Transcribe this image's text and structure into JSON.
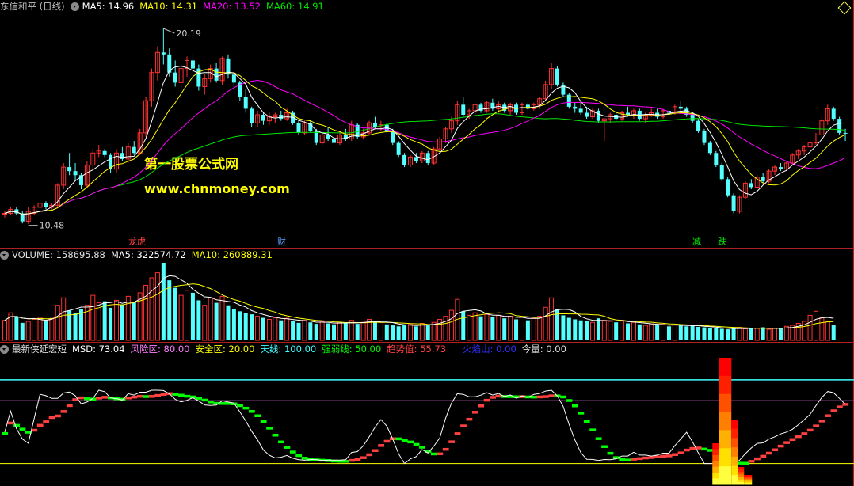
{
  "header_main": {
    "stock": "东信和平 (日线)",
    "ma5": "MA5: 14.96",
    "ma10": "MA10: 14.31",
    "ma20": "MA20: 13.52",
    "ma60": "MA60: 14.91"
  },
  "header_volume": {
    "volume": "VOLUME: 158695.88",
    "ma5": "MA5: 322574.72",
    "ma10": "MA10: 260889.31"
  },
  "header_ind": {
    "name": "最新侠延宏短",
    "msd": "MSD: 73.04",
    "risk": "风险区: 80.00",
    "safe": "安全区: 20.00",
    "sky": "天线: 100.00",
    "strong": "强弱线: 50.00",
    "trend": "趋势值: 55.73",
    "volcano": "火焰山: 0.00",
    "today": "今量: 0.00"
  },
  "watermark": {
    "line1": "第一股票公式网",
    "line2": "www.chnmoney.com"
  },
  "annotations": {
    "high": "20.19",
    "low": "10.48"
  },
  "event_tags": [
    "龙虎",
    "财",
    "减",
    "跌"
  ],
  "colors": {
    "up": "#ff3232",
    "down": "#54ffff",
    "ma5": "#ffffff",
    "ma10": "#ffff00",
    "ma20": "#ff00ff",
    "ma60": "#00e600",
    "risk": "#ff80ff",
    "sky": "#40ffff",
    "strong": "#00ff00",
    "trend": "#ff4040",
    "volcano": "#0000ff"
  },
  "chart_data": {
    "type": "candlestick",
    "price_range": [
      9.8,
      20.9
    ],
    "candles": [
      [
        11.0,
        11.1,
        10.8,
        11.0
      ],
      [
        11.0,
        11.3,
        10.9,
        11.2
      ],
      [
        11.2,
        11.3,
        10.9,
        11.0
      ],
      [
        11.0,
        11.1,
        10.5,
        10.6
      ],
      [
        10.6,
        11.3,
        10.48,
        11.1
      ],
      [
        11.0,
        11.4,
        10.9,
        11.3
      ],
      [
        11.3,
        11.6,
        11.1,
        11.5
      ],
      [
        11.5,
        11.6,
        11.2,
        11.3
      ],
      [
        11.3,
        11.5,
        11.2,
        11.4
      ],
      [
        11.4,
        12.5,
        11.3,
        12.4
      ],
      [
        12.4,
        13.5,
        12.2,
        13.3
      ],
      [
        13.3,
        14.0,
        12.9,
        13.1
      ],
      [
        13.1,
        13.5,
        12.6,
        12.9
      ],
      [
        12.9,
        13.0,
        12.2,
        12.4
      ],
      [
        12.4,
        13.6,
        12.3,
        13.4
      ],
      [
        13.4,
        14.2,
        13.2,
        14.0
      ],
      [
        14.0,
        14.4,
        13.8,
        14.1
      ],
      [
        14.1,
        14.2,
        13.8,
        13.9
      ],
      [
        13.9,
        14.0,
        13.0,
        13.2
      ],
      [
        13.2,
        14.2,
        13.0,
        14.0
      ],
      [
        14.0,
        14.3,
        13.6,
        13.7
      ],
      [
        13.7,
        14.5,
        13.5,
        14.3
      ],
      [
        14.3,
        14.6,
        13.9,
        14.0
      ],
      [
        14.0,
        15.2,
        13.9,
        15.0
      ],
      [
        15.0,
        16.8,
        14.8,
        16.6
      ],
      [
        16.6,
        18.2,
        16.3,
        18.0
      ],
      [
        18.0,
        19.3,
        17.6,
        19.0
      ],
      [
        19.0,
        20.19,
        18.4,
        18.9
      ],
      [
        18.9,
        19.2,
        17.8,
        18.0
      ],
      [
        18.0,
        18.6,
        17.3,
        17.5
      ],
      [
        17.5,
        18.4,
        17.2,
        18.2
      ],
      [
        18.2,
        18.8,
        17.8,
        18.6
      ],
      [
        18.6,
        18.9,
        18.0,
        18.2
      ],
      [
        18.2,
        18.4,
        17.1,
        17.3
      ],
      [
        17.3,
        17.9,
        16.9,
        17.7
      ],
      [
        17.7,
        18.4,
        17.5,
        18.2
      ],
      [
        18.2,
        18.5,
        17.5,
        17.6
      ],
      [
        17.6,
        18.8,
        17.4,
        18.7
      ],
      [
        18.7,
        18.9,
        17.7,
        17.9
      ],
      [
        17.9,
        18.0,
        17.2,
        17.5
      ],
      [
        17.5,
        17.6,
        16.6,
        16.8
      ],
      [
        16.8,
        17.2,
        16.0,
        16.2
      ],
      [
        16.2,
        16.3,
        15.3,
        15.5
      ],
      [
        15.5,
        16.1,
        15.3,
        15.9
      ],
      [
        15.9,
        16.0,
        15.4,
        15.6
      ],
      [
        15.6,
        16.0,
        15.4,
        15.8
      ],
      [
        15.8,
        16.0,
        15.5,
        15.9
      ],
      [
        15.9,
        16.1,
        15.6,
        15.7
      ],
      [
        15.7,
        16.2,
        15.6,
        16.0
      ],
      [
        16.0,
        16.1,
        15.4,
        15.5
      ],
      [
        15.5,
        15.6,
        14.9,
        15.0
      ],
      [
        15.0,
        15.6,
        14.9,
        15.5
      ],
      [
        15.5,
        15.6,
        15.0,
        15.1
      ],
      [
        15.1,
        15.2,
        14.4,
        14.5
      ],
      [
        14.5,
        15.0,
        14.4,
        14.9
      ],
      [
        14.9,
        15.3,
        14.6,
        14.7
      ],
      [
        14.7,
        14.8,
        14.3,
        14.5
      ],
      [
        14.5,
        15.0,
        14.4,
        14.9
      ],
      [
        14.9,
        15.2,
        14.6,
        14.7
      ],
      [
        14.7,
        15.6,
        14.6,
        15.4
      ],
      [
        15.4,
        15.5,
        14.7,
        14.8
      ],
      [
        14.8,
        15.2,
        14.7,
        15.0
      ],
      [
        15.0,
        15.6,
        14.9,
        15.5
      ],
      [
        15.5,
        15.8,
        15.2,
        15.3
      ],
      [
        15.3,
        15.6,
        15.1,
        15.4
      ],
      [
        15.4,
        15.5,
        15.0,
        15.1
      ],
      [
        15.1,
        15.2,
        14.4,
        14.5
      ],
      [
        14.5,
        14.6,
        13.8,
        13.9
      ],
      [
        13.9,
        14.0,
        13.3,
        13.4
      ],
      [
        13.4,
        13.9,
        13.3,
        13.8
      ],
      [
        13.8,
        14.0,
        13.5,
        13.6
      ],
      [
        13.6,
        14.1,
        13.5,
        14.0
      ],
      [
        14.0,
        14.1,
        13.4,
        13.5
      ],
      [
        13.5,
        14.3,
        13.4,
        14.2
      ],
      [
        14.2,
        14.8,
        14.0,
        14.7
      ],
      [
        14.7,
        15.3,
        14.5,
        15.2
      ],
      [
        15.2,
        15.8,
        15.0,
        15.6
      ],
      [
        15.6,
        16.6,
        15.4,
        16.4
      ],
      [
        16.4,
        16.8,
        15.8,
        15.9
      ],
      [
        15.9,
        16.2,
        15.7,
        16.1
      ],
      [
        16.1,
        16.6,
        15.9,
        16.4
      ],
      [
        16.4,
        16.5,
        16.0,
        16.1
      ],
      [
        16.1,
        16.6,
        16.0,
        16.5
      ],
      [
        16.5,
        16.7,
        16.1,
        16.2
      ],
      [
        16.2,
        16.6,
        16.0,
        16.4
      ],
      [
        16.4,
        16.5,
        16.0,
        16.1
      ],
      [
        16.1,
        16.5,
        15.9,
        16.4
      ],
      [
        16.4,
        16.5,
        15.9,
        16.0
      ],
      [
        16.0,
        16.5,
        15.9,
        16.4
      ],
      [
        16.4,
        16.5,
        16.1,
        16.2
      ],
      [
        16.2,
        16.5,
        16.1,
        16.4
      ],
      [
        16.4,
        16.8,
        16.2,
        16.7
      ],
      [
        16.7,
        17.6,
        16.6,
        17.4
      ],
      [
        17.4,
        18.5,
        17.2,
        18.2
      ],
      [
        18.2,
        18.3,
        17.3,
        17.4
      ],
      [
        17.4,
        17.5,
        16.8,
        16.9
      ],
      [
        16.9,
        17.0,
        16.2,
        16.3
      ],
      [
        16.3,
        16.5,
        16.0,
        16.2
      ],
      [
        16.2,
        16.6,
        15.9,
        16.0
      ],
      [
        16.0,
        16.3,
        15.7,
        15.8
      ],
      [
        15.8,
        16.2,
        15.7,
        16.1
      ],
      [
        16.1,
        16.2,
        15.5,
        15.6
      ],
      [
        15.6,
        15.7,
        14.6,
        15.7
      ],
      [
        15.7,
        16.0,
        15.5,
        15.9
      ],
      [
        15.9,
        16.0,
        15.6,
        15.7
      ],
      [
        15.7,
        16.1,
        15.6,
        16.0
      ],
      [
        16.0,
        16.3,
        15.8,
        15.9
      ],
      [
        15.9,
        16.2,
        15.7,
        16.1
      ],
      [
        16.1,
        16.2,
        15.6,
        15.7
      ],
      [
        15.7,
        16.0,
        15.5,
        15.9
      ],
      [
        15.9,
        16.2,
        15.8,
        16.0
      ],
      [
        16.0,
        16.2,
        15.7,
        15.8
      ],
      [
        15.8,
        16.2,
        15.7,
        16.1
      ],
      [
        16.1,
        16.3,
        15.9,
        16.0
      ],
      [
        16.0,
        16.4,
        15.9,
        16.3
      ],
      [
        16.3,
        16.6,
        16.1,
        16.2
      ],
      [
        16.2,
        16.3,
        15.8,
        15.9
      ],
      [
        15.9,
        16.0,
        15.5,
        15.6
      ],
      [
        15.6,
        15.7,
        15.0,
        15.1
      ],
      [
        15.1,
        15.2,
        14.4,
        14.5
      ],
      [
        14.5,
        14.6,
        13.9,
        14.0
      ],
      [
        14.0,
        14.1,
        13.3,
        13.4
      ],
      [
        13.4,
        13.5,
        12.6,
        12.7
      ],
      [
        12.7,
        12.8,
        11.8,
        11.9
      ],
      [
        11.9,
        12.0,
        11.0,
        11.1
      ],
      [
        11.1,
        11.9,
        11.0,
        11.8
      ],
      [
        11.8,
        12.6,
        11.7,
        12.5
      ],
      [
        12.5,
        12.7,
        12.2,
        12.3
      ],
      [
        12.3,
        12.9,
        12.2,
        12.8
      ],
      [
        12.8,
        13.0,
        12.5,
        12.6
      ],
      [
        12.6,
        13.2,
        12.5,
        13.1
      ],
      [
        13.1,
        13.4,
        12.9,
        13.3
      ],
      [
        13.3,
        13.5,
        13.1,
        13.2
      ],
      [
        13.2,
        13.6,
        13.1,
        13.5
      ],
      [
        13.5,
        14.0,
        13.4,
        13.9
      ],
      [
        13.9,
        14.2,
        13.7,
        14.1
      ],
      [
        14.1,
        14.4,
        13.9,
        14.3
      ],
      [
        14.3,
        14.6,
        14.1,
        14.5
      ],
      [
        14.5,
        15.0,
        14.4,
        14.9
      ],
      [
        14.9,
        15.8,
        14.8,
        15.6
      ],
      [
        15.6,
        16.4,
        15.4,
        16.2
      ],
      [
        16.2,
        16.3,
        15.6,
        15.7
      ],
      [
        15.7,
        15.8,
        14.9,
        15.0
      ],
      [
        15.0,
        15.2,
        14.6,
        14.96
      ]
    ],
    "volume": [
      40,
      55,
      48,
      35,
      38,
      42,
      46,
      40,
      44,
      70,
      85,
      60,
      55,
      62,
      70,
      90,
      75,
      78,
      65,
      80,
      72,
      88,
      76,
      95,
      110,
      125,
      135,
      155,
      120,
      105,
      90,
      100,
      95,
      80,
      70,
      85,
      75,
      88,
      70,
      62,
      58,
      55,
      52,
      48,
      45,
      42,
      45,
      40,
      44,
      38,
      35,
      40,
      36,
      33,
      38,
      34,
      32,
      36,
      34,
      40,
      33,
      36,
      42,
      38,
      36,
      32,
      30,
      28,
      30,
      32,
      28,
      34,
      30,
      36,
      42,
      48,
      60,
      82,
      58,
      50,
      55,
      48,
      52,
      46,
      50,
      44,
      48,
      42,
      46,
      40,
      44,
      48,
      66,
      85,
      62,
      50,
      45,
      42,
      40,
      38,
      36,
      44,
      40,
      38,
      36,
      40,
      34,
      36,
      32,
      30,
      33,
      30,
      32,
      28,
      31,
      30,
      28,
      30,
      27,
      26,
      25,
      24,
      23,
      22,
      24,
      26,
      23,
      25,
      24,
      26,
      22,
      24,
      25,
      28,
      30,
      34,
      38,
      50,
      58,
      45,
      38,
      30
    ],
    "indicator_levels": {
      "sky": 100,
      "risk": 80,
      "strong": 50,
      "safe": 20
    },
    "msd_current": 73.04,
    "trend_current": 55.73,
    "high_label": 20.19,
    "low_label": 10.48
  }
}
